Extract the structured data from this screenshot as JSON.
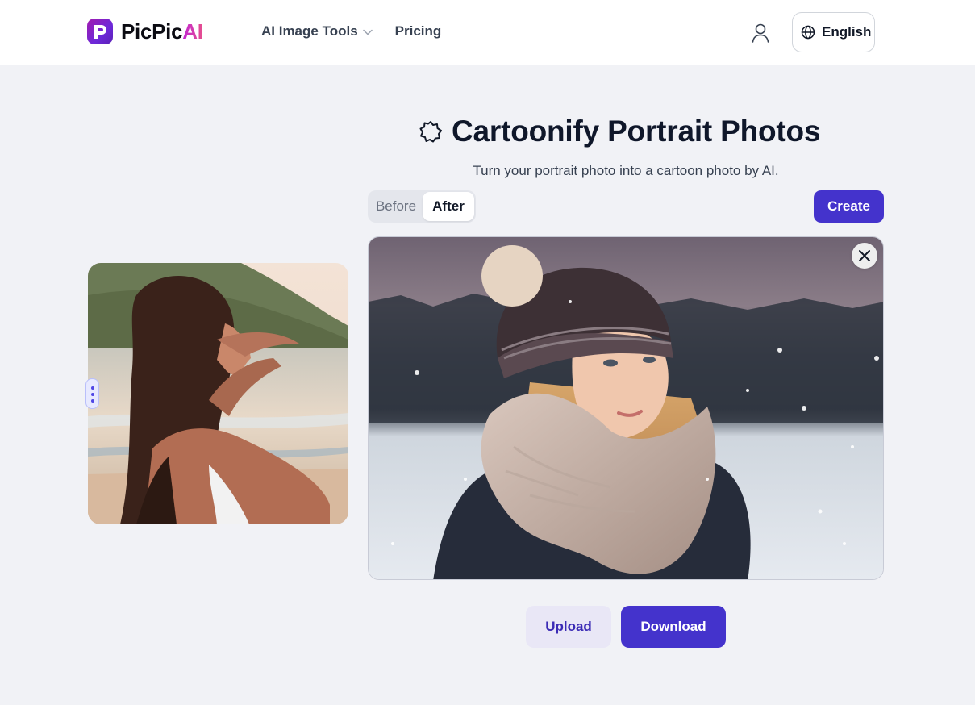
{
  "header": {
    "logo_prefix": "PicPic",
    "logo_suffix": "AI",
    "nav": [
      {
        "label": "AI Image Tools",
        "icon": "chevron-down-icon"
      },
      {
        "label": "Pricing"
      }
    ],
    "user_icon": "user-icon",
    "language": {
      "label": "English",
      "icon": "globe-icon"
    }
  },
  "main": {
    "title": "Cartoonify Portrait Photos",
    "title_icon": "badge-star-icon",
    "subtitle": "Turn your portrait photo into a cartoon photo by AI.",
    "toggle": {
      "before": "Before",
      "after": "After",
      "selected": "After"
    },
    "create_label": "Create",
    "upload_label": "Upload",
    "download_label": "Download"
  },
  "colors": {
    "accent": "#4433cc",
    "background": "#f1f2f6",
    "logo_gradient": [
      "#a21caf",
      "#6d28d9"
    ]
  }
}
